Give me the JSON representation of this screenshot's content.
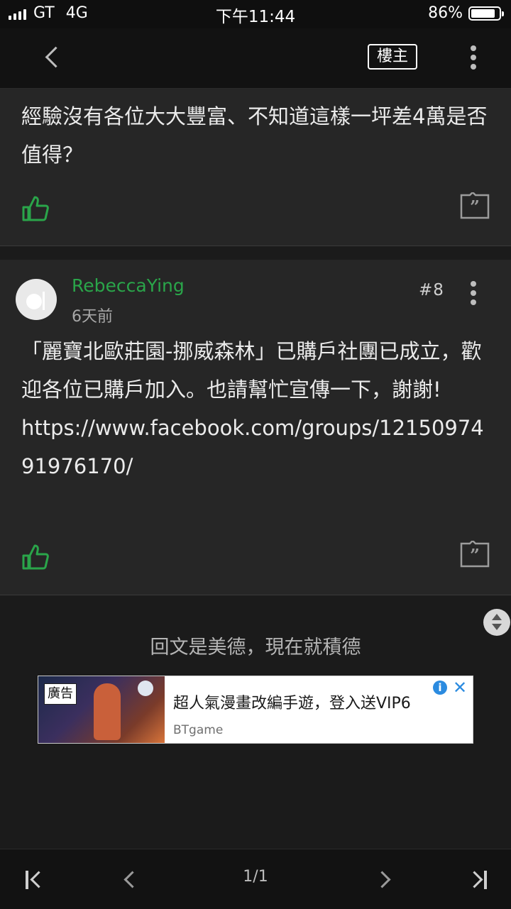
{
  "status_bar": {
    "carrier": "GT",
    "network": "4G",
    "time": "下午11:44",
    "battery": "86%",
    "battery_level": 0.86
  },
  "nav": {
    "op_label": "樓主"
  },
  "post_prev": {
    "text": "經驗沒有各位大大豐富、不知道這樣一坪差4萬是否值得？"
  },
  "post_8": {
    "author": "RebeccaYing",
    "time": "6天前",
    "floor": "#8",
    "text": "「麗寶北歐莊園-挪威森林」已購戶社團已成立，歡迎各位已購戶加入。也請幫忙宣傳一下，謝謝!",
    "link": "https://www.facebook.com/groups/1215097491976170/"
  },
  "footer_prompt": "回文是美德，現在就積德",
  "ad": {
    "badge": "廣告",
    "title": "超人氣漫畫改編手遊，登入送VIP6",
    "source": "BTgame"
  },
  "pager": {
    "page_indicator": "1/1"
  },
  "colors": {
    "accent_green": "#2aa54a",
    "background": "#1b1b1b",
    "card": "#262626"
  }
}
